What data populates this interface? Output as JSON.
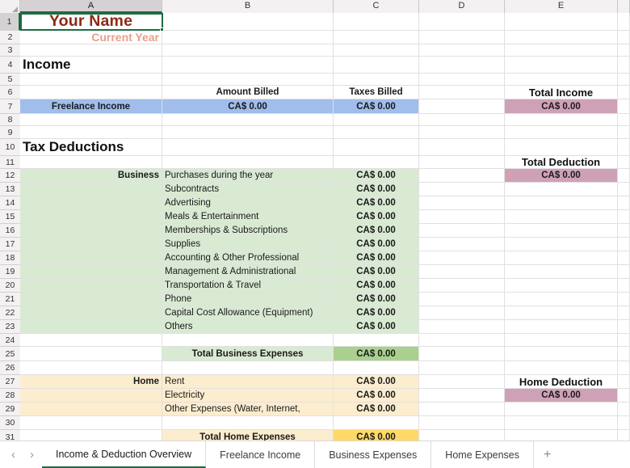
{
  "app": {
    "type": "spreadsheet"
  },
  "columns": [
    "A",
    "B",
    "C",
    "D",
    "E"
  ],
  "selected_column": "A",
  "selected_cell": "A1",
  "row_numbers": [
    1,
    2,
    3,
    4,
    5,
    6,
    7,
    8,
    9,
    10,
    11,
    12,
    13,
    14,
    15,
    16,
    17,
    18,
    19,
    20,
    21,
    22,
    23,
    24,
    25,
    26,
    27,
    28,
    29,
    30,
    31
  ],
  "title": {
    "name": "Your Name",
    "year": "Current Year"
  },
  "sections": {
    "income": {
      "heading": "Income",
      "col_b_header": "Amount Billed",
      "col_c_header": "Taxes Billed",
      "col_e_header": "Total Income",
      "row_label": "Freelance Income",
      "amount_billed": "CA$ 0.00",
      "taxes_billed": "CA$ 0.00",
      "total_income": "CA$ 0.00"
    },
    "deductions": {
      "heading": "Tax Deductions",
      "total_deduction_header": "Total Deduction",
      "total_deduction_value": "CA$ 0.00",
      "business_group_label": "Business",
      "business_items": [
        {
          "label": "Purchases during the year",
          "amount": "CA$ 0.00"
        },
        {
          "label": "Subcontracts",
          "amount": "CA$ 0.00"
        },
        {
          "label": "Advertising",
          "amount": "CA$ 0.00"
        },
        {
          "label": "Meals & Entertainment",
          "amount": "CA$ 0.00"
        },
        {
          "label": "Memberships & Subscriptions",
          "amount": "CA$ 0.00"
        },
        {
          "label": "Supplies",
          "amount": "CA$ 0.00"
        },
        {
          "label": "Accounting & Other Professional",
          "amount": "CA$ 0.00"
        },
        {
          "label": "Management & Administrational",
          "amount": "CA$ 0.00"
        },
        {
          "label": "Transportation & Travel",
          "amount": "CA$ 0.00"
        },
        {
          "label": "Phone",
          "amount": "CA$ 0.00"
        },
        {
          "label": "Capital Cost Allowance (Equipment)",
          "amount": "CA$ 0.00"
        },
        {
          "label": "Others",
          "amount": "CA$ 0.00"
        }
      ],
      "business_total_label": "Total Business Expenses",
      "business_total_value": "CA$ 0.00",
      "home_group_label": "Home",
      "home_deduction_header": "Home Deduction",
      "home_deduction_value": "CA$ 0.00",
      "home_items": [
        {
          "label": "Rent",
          "amount": "CA$ 0.00"
        },
        {
          "label": "Electricity",
          "amount": "CA$ 0.00"
        },
        {
          "label": "Other Expenses (Water, Internet,",
          "amount": "CA$ 0.00"
        }
      ],
      "home_total_label": "Total Home Expenses",
      "home_total_value": "CA$ 0.00"
    }
  },
  "tabbar": {
    "prev_arrow": "‹",
    "next_arrow": "›",
    "add_sheet": "+",
    "tabs": [
      {
        "label": "Income & Deduction Overview",
        "active": true
      },
      {
        "label": "Freelance Income",
        "active": false
      },
      {
        "label": "Business Expenses",
        "active": false
      },
      {
        "label": "Home Expenses",
        "active": false
      }
    ]
  },
  "colors": {
    "income_row": "#a0bdec",
    "total_badge": "#cfa1b7",
    "business_fill": "#d9ead3",
    "business_total": "#a9d08e",
    "home_fill": "#fcedce",
    "home_total": "#ffd966",
    "accent": "#1e6b42",
    "title_name": "#8b2b16",
    "title_year": "#e8a08c"
  }
}
